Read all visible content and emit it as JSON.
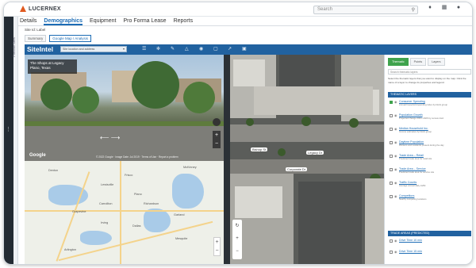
{
  "brand": {
    "name": "LUCERNEX"
  },
  "search": {
    "placeholder": "Search"
  },
  "top_icons": [
    {
      "icon": "bell-icon"
    },
    {
      "icon": "grid-icon"
    },
    {
      "icon": "user-icon"
    },
    {
      "icon": "help-icon"
    }
  ],
  "tabs": [
    "Details",
    "Demographics",
    "Equipment",
    "Pro Forma Lease",
    "Reports"
  ],
  "active_tab": "Demographics",
  "site": {
    "label": "Site Id: Label"
  },
  "subtabs": [
    "Summary",
    "Google Map / Analysis"
  ],
  "siteintel": {
    "title": "SiteIntel",
    "select_value": "Site location and address",
    "tools": [
      "layers-icon",
      "settings-icon",
      "pencil-icon",
      "flask-icon",
      "pin-icon",
      "print-icon",
      "share-icon",
      "export-icon"
    ]
  },
  "streetview": {
    "location_label": "The Shops at Legacy",
    "location_sub": "Plano, Texas",
    "google": "Google",
    "copyright": "© 2022 Google · Image Date: Jul 2019 · Terms of Use · Report a problem"
  },
  "roadmap": {
    "labels": [
      "Denton",
      "Lewisville",
      "Frisco",
      "McKinney",
      "Carrollton",
      "Plano",
      "Richardson",
      "Irving",
      "Dallas",
      "Grapevine",
      "Mesquite",
      "Garland",
      "Arlington"
    ]
  },
  "aerial": {
    "labels": [
      "Legacy Dr",
      "Bishop St",
      "Corporate Dr"
    ]
  },
  "panel": {
    "tabs": [
      "Thematic",
      "Points",
      "Layers"
    ],
    "active_tab": "Thematic",
    "search_placeholder": "Search thematic layers",
    "description": "Select the thematic layers that you want to display on the map. Click the name of a layer to change its properties and legend.",
    "section_primary": "THEMATIC LAYERS",
    "section_secondary": "TRADE AREAS (PREDICTED)",
    "items": [
      {
        "name": "Consumer Spending",
        "sub": "Annual household spending index by block group",
        "on": true
      },
      {
        "name": "Population Growth",
        "sub": "Projected change 2021–2026 by census tract",
        "on": false
      },
      {
        "name": "Median Household Inc.",
        "sub": "Income estimates by block group",
        "on": false
      },
      {
        "name": "Daytime Population",
        "sub": "Workers and residents present during the day",
        "on": false
      },
      {
        "name": "Trade Area – Retail",
        "sub": "Predicted trade area for retail site",
        "on": false
      },
      {
        "name": "Trade Area – Service",
        "sub": "Predicted trade area for service site",
        "on": false
      },
      {
        "name": "Traffic Counts",
        "sub": "Average annual daily traffic",
        "on": false
      },
      {
        "name": "Competitors",
        "sub": "Nearby competing locations",
        "on": false
      }
    ],
    "items_secondary": [
      {
        "name": "Drive Time 10 min",
        "sub": "",
        "on": false
      },
      {
        "name": "Drive Time 15 min",
        "sub": "",
        "on": false
      }
    ]
  }
}
